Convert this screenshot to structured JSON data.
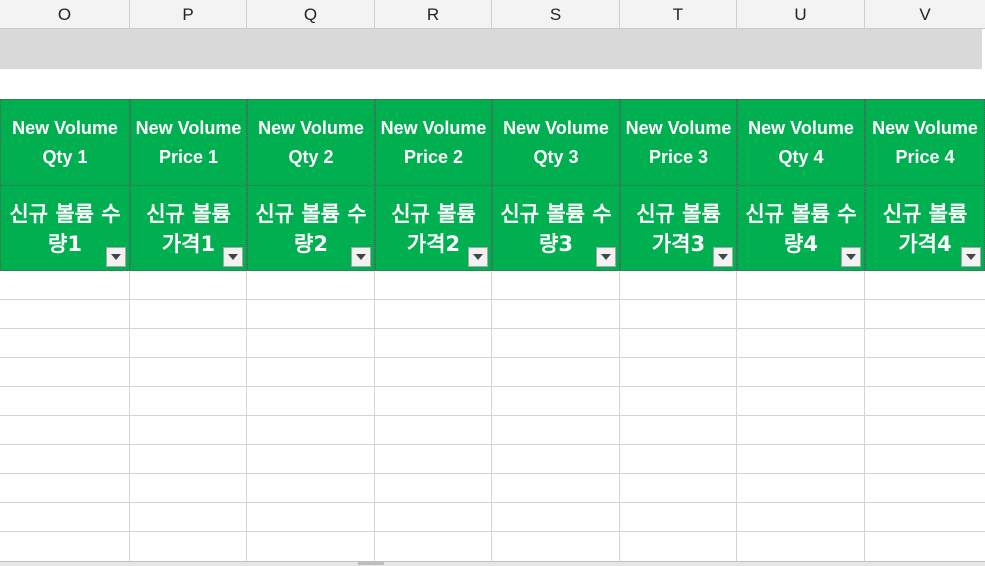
{
  "column_headers": [
    "O",
    "P",
    "Q",
    "R",
    "S",
    "T",
    "U",
    "V"
  ],
  "fields": [
    {
      "en": "New Volume Qty 1",
      "ko": "신규 볼륨 수량1"
    },
    {
      "en": "New Volume Price 1",
      "ko": "신규 볼륨 가격1"
    },
    {
      "en": "New Volume Qty 2",
      "ko": "신규 볼륨 수량2"
    },
    {
      "en": "New Volume Price 2",
      "ko": "신규 볼륨 가격2"
    },
    {
      "en": "New Volume Qty 3",
      "ko": "신규 볼륨 수량3"
    },
    {
      "en": "New Volume Price 3",
      "ko": "신규 볼륨 가격3"
    },
    {
      "en": "New Volume Qty 4",
      "ko": "신규 볼륨 수량4"
    },
    {
      "en": "New Volume Price 4",
      "ko": "신규 볼륨 가격4"
    }
  ],
  "colors": {
    "header_fill": "#00b050",
    "header_text": "#ffffff",
    "band_fill": "#d9d9d9",
    "gridline": "#d4d4d4"
  },
  "icons": {
    "filter": "chevron-down-icon"
  }
}
